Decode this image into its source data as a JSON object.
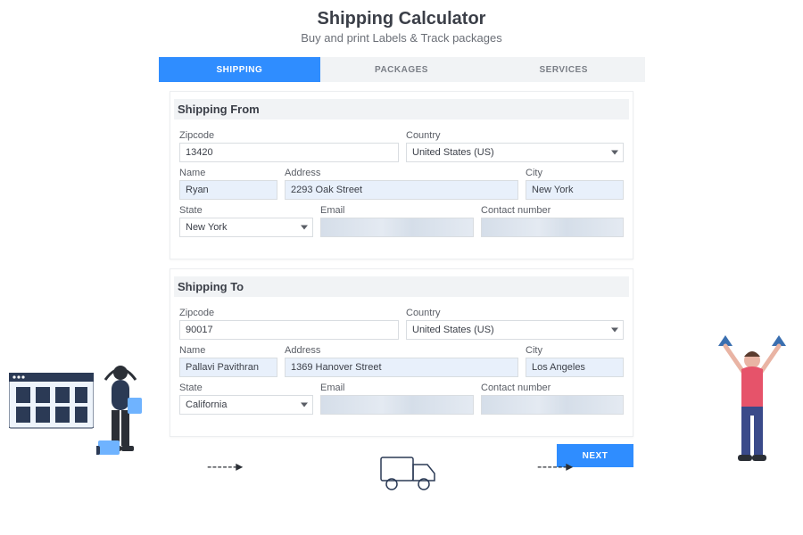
{
  "header": {
    "title": "Shipping Calculator",
    "subtitle": "Buy and print Labels & Track packages"
  },
  "tabs": {
    "shipping": "SHIPPING",
    "packages": "PACKAGES",
    "services": "SERVICES"
  },
  "from": {
    "section": "Shipping From",
    "labels": {
      "zipcode": "Zipcode",
      "country": "Country",
      "name": "Name",
      "address": "Address",
      "city": "City",
      "state": "State",
      "email": "Email",
      "contact": "Contact number"
    },
    "values": {
      "zipcode": "13420",
      "country": "United States (US)",
      "name": "Ryan",
      "address": "2293 Oak Street",
      "city": "New York",
      "state": "New York",
      "email": "",
      "contact": ""
    }
  },
  "to": {
    "section": "Shipping To",
    "labels": {
      "zipcode": "Zipcode",
      "country": "Country",
      "name": "Name",
      "address": "Address",
      "city": "City",
      "state": "State",
      "email": "Email",
      "contact": "Contact number"
    },
    "values": {
      "zipcode": "90017",
      "country": "United States (US)",
      "name": "Pallavi Pavithran",
      "address": "1369 Hanover Street",
      "city": "Los Angeles",
      "state": "California",
      "email": "",
      "contact": ""
    }
  },
  "buttons": {
    "next": "NEXT"
  }
}
